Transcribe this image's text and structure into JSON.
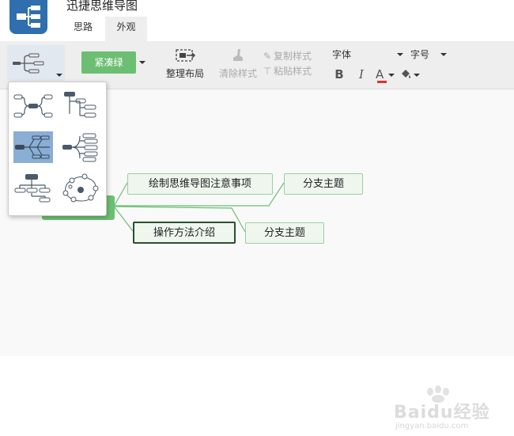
{
  "app": {
    "title": "迅捷思维导图",
    "logo_icon": "mindmap-logo-icon"
  },
  "menu": {
    "tabs": [
      {
        "label": "思路",
        "active": false
      },
      {
        "label": "外观",
        "active": true
      }
    ]
  },
  "toolbar": {
    "layout_icon": "layout-structure-icon",
    "theme_label": "紧凑绿",
    "theme_color": "#6cbf72",
    "arrange_label": "整理布局",
    "clear_style_label": "清除样式",
    "copy_style_label": "复制样式",
    "paste_style_label": "粘贴样式",
    "font_label": "字体",
    "size_label": "字号",
    "bold_label": "B",
    "italic_label": "I",
    "font_color_label": "A",
    "font_color": "#e03030"
  },
  "layout_panel": {
    "options": [
      {
        "icon": "mindmap-layout-icon",
        "selected": false
      },
      {
        "icon": "org-tree-layout-icon",
        "selected": false
      },
      {
        "icon": "fishbone-layout-icon",
        "selected": true
      },
      {
        "icon": "right-logic-layout-icon",
        "selected": false
      },
      {
        "icon": "org-chart-layout-icon",
        "selected": false
      },
      {
        "icon": "bubble-layout-icon",
        "selected": false
      }
    ]
  },
  "canvas": {
    "central_topic": "",
    "topics": [
      {
        "label": "绘制思维导图注意事项"
      },
      {
        "label": "分支主题"
      },
      {
        "label": "操作方法介绍",
        "selected": true
      },
      {
        "label": "分支主题"
      }
    ],
    "line_color": "#6cbf72"
  },
  "watermark": {
    "text": "Baidu经验",
    "sub": "jingyan.baidu.com"
  }
}
